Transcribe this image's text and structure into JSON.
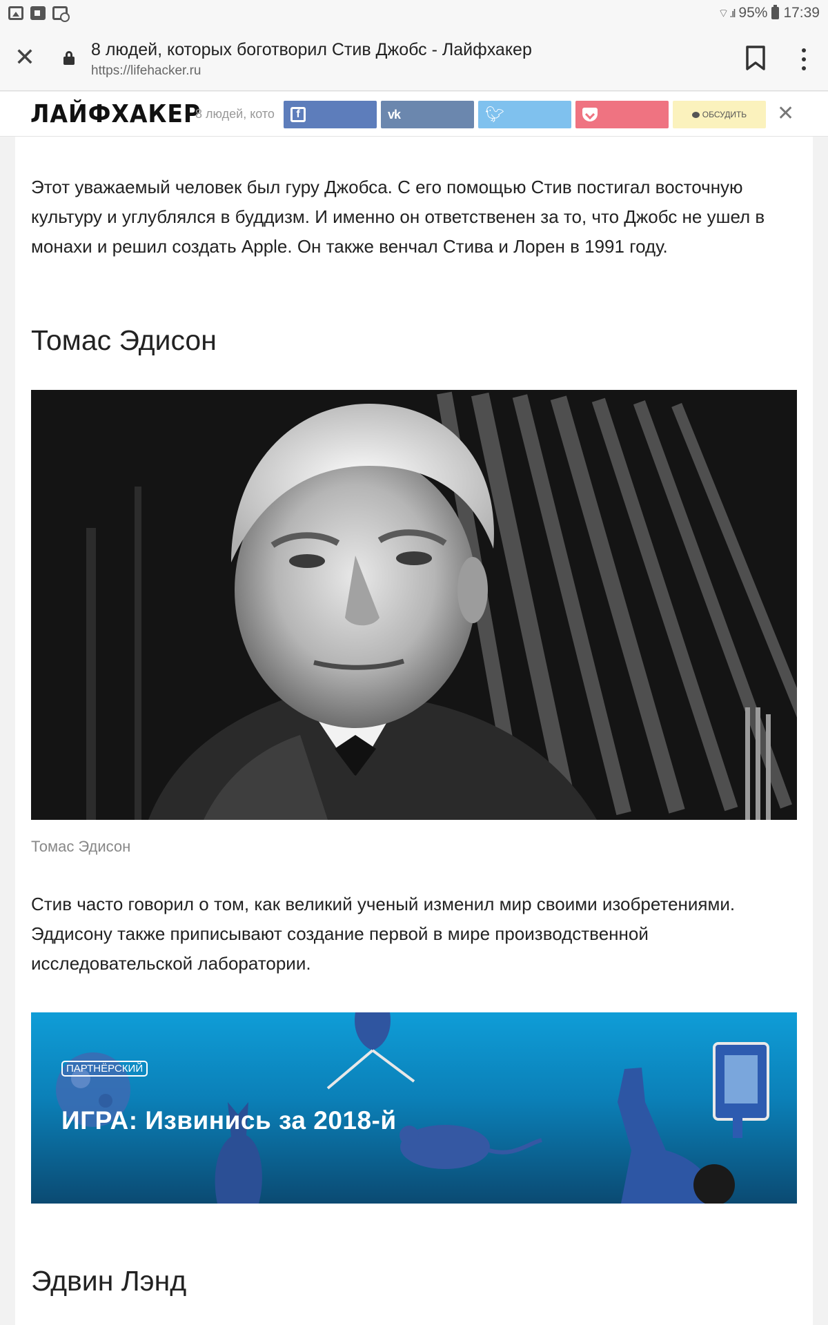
{
  "status_bar": {
    "battery": "95%",
    "time": "17:39"
  },
  "browser": {
    "page_title": "8 людей, которых боготворил Стив Джобс - Лайфхакер",
    "url": "https://lifehacker.ru"
  },
  "site_header": {
    "logo": "ЛАЙФХАКЕР",
    "excerpt": "8 людей, кото",
    "discuss_label": "ОБСУДИТЬ"
  },
  "article": {
    "para1": "Этот уважаемый человек был гуру Джобса. С его помощью Стив постигал восточную культуру и углублялся в буддизм. И именно он ответственен за то, что Джобс не ушел в монахи и решил создать Apple. Он также венчал Стива и Лорен в 1991 году.",
    "heading_edison": "Томас Эдисон",
    "photo_caption": "Томас Эдисон",
    "para2": "Стив часто говорил о том, как великий ученый изменил мир своими изобретениями. Эддисону также приписывают создание первой в мире производственной исследовательской лаборатории.",
    "promo": {
      "badge": "ПАРТНЁРСКИЙ",
      "title": "ИГРА: Извинись за 2018-й"
    },
    "heading_land": "Эдвин Лэнд"
  }
}
